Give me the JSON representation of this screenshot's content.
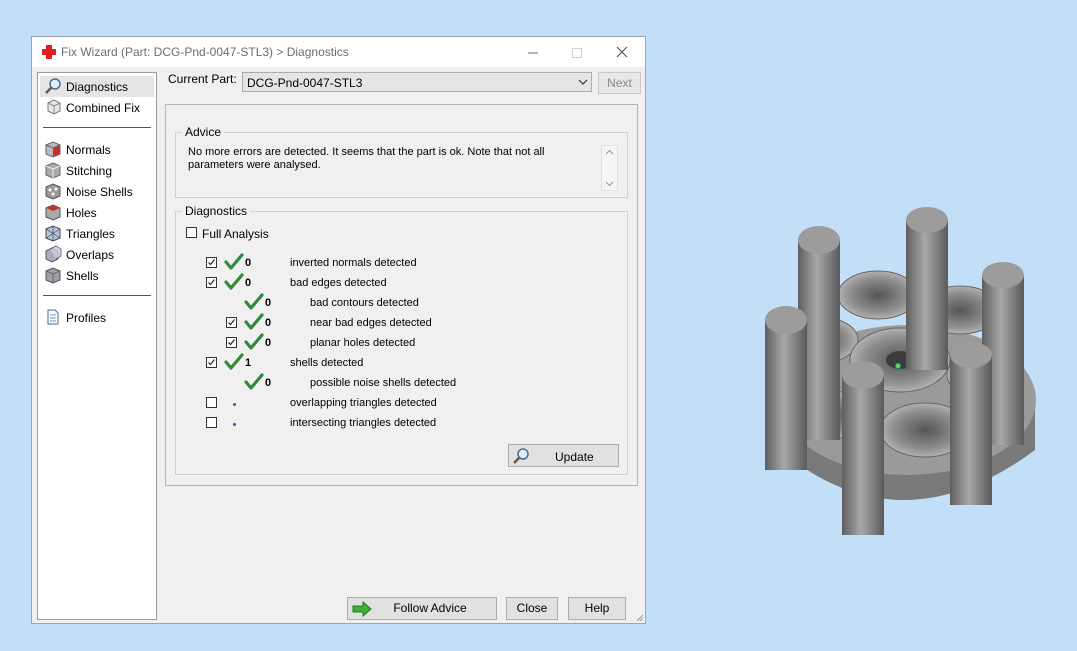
{
  "window": {
    "title": "Fix Wizard (Part: DCG-Pnd-0047-STL3) > Diagnostics"
  },
  "sidebar": {
    "items": [
      {
        "label": "Diagnostics",
        "icon": "magnifier-icon",
        "selected": true
      },
      {
        "label": "Combined Fix",
        "icon": "cube-icon"
      },
      {
        "label": "Normals",
        "icon": "normals-cube-icon"
      },
      {
        "label": "Stitching",
        "icon": "stitching-cube-icon"
      },
      {
        "label": "Noise Shells",
        "icon": "noise-cube-icon"
      },
      {
        "label": "Holes",
        "icon": "holes-cube-icon"
      },
      {
        "label": "Triangles",
        "icon": "triangles-cube-icon"
      },
      {
        "label": "Overlaps",
        "icon": "overlaps-cube-icon"
      },
      {
        "label": "Shells",
        "icon": "shells-cube-icon"
      },
      {
        "label": "Profiles",
        "icon": "document-icon"
      }
    ]
  },
  "header": {
    "current_part_label": "Current Part:",
    "current_part_value": "DCG-Pnd-0047-STL3",
    "next_label": "Next"
  },
  "advice": {
    "title": "Advice",
    "text": "No more errors are detected. It seems that the part is ok. Note that not all parameters were analysed."
  },
  "diagnostics": {
    "title": "Diagnostics",
    "full_analysis_label": "Full Analysis",
    "full_analysis_checked": false,
    "rows": [
      {
        "checkbox": true,
        "checked": true,
        "status": "ok",
        "count": "0",
        "label": "inverted normals detected",
        "indent": 0
      },
      {
        "checkbox": true,
        "checked": true,
        "status": "ok",
        "count": "0",
        "label": "bad edges detected",
        "indent": 0
      },
      {
        "checkbox": false,
        "checked": false,
        "status": "ok",
        "count": "0",
        "label": "bad contours detected",
        "indent": 1
      },
      {
        "checkbox": true,
        "checked": true,
        "status": "ok",
        "count": "0",
        "label": "near bad edges detected",
        "indent": 1
      },
      {
        "checkbox": true,
        "checked": true,
        "status": "ok",
        "count": "0",
        "label": "planar holes detected",
        "indent": 1
      },
      {
        "checkbox": true,
        "checked": true,
        "status": "ok",
        "count": "1",
        "label": "shells detected",
        "indent": 0
      },
      {
        "checkbox": false,
        "checked": false,
        "status": "ok",
        "count": "0",
        "label": "possible noise shells detected",
        "indent": 1
      },
      {
        "checkbox": true,
        "checked": false,
        "status": "none",
        "count": "",
        "label": "overlapping triangles detected",
        "indent": 0
      },
      {
        "checkbox": true,
        "checked": false,
        "status": "none",
        "count": "",
        "label": "intersecting triangles detected",
        "indent": 0
      }
    ],
    "update_label": "Update"
  },
  "footer": {
    "follow_advice_label": "Follow Advice",
    "close_label": "Close",
    "help_label": "Help"
  },
  "colors": {
    "desktop": "#c3dff7",
    "tick": "#2e8b3e",
    "model": "#8a8a8a"
  }
}
